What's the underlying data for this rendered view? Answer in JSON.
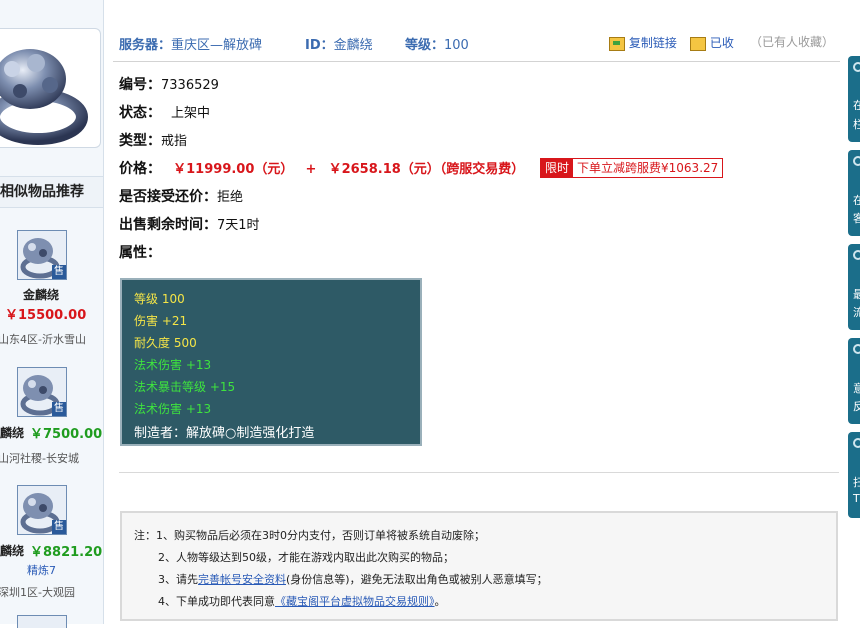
{
  "header": {
    "server_label": "服务器：",
    "server_value": "重庆区—解放碑",
    "id_label": "ID：",
    "id_value": "金麟绕",
    "level_label": "等级：",
    "level_value": "100",
    "copy_link": "复制链接",
    "collected": "已收",
    "watermark": "（已有人收藏）"
  },
  "item": {
    "number_label": "编号：",
    "number_value": "7336529",
    "status_label": "状态：",
    "status_value": "上架中",
    "type_label": "类型：",
    "type_value": "戒指",
    "price_label": "价格：",
    "price_main": "￥11999.00（元）",
    "price_plus": "+",
    "price_fee": "￥2658.18（元）（跨服交易费）",
    "promo_tag": "限时",
    "promo_text": "下单立减跨服费¥1063.27",
    "bargain_label": "是否接受还价：",
    "bargain_value": "拒绝",
    "remaining_label": "出售剩余时间：",
    "remaining_value": "7天1时",
    "attr_label": "属性："
  },
  "stats": [
    {
      "text": "等级 100",
      "color": "#f5e547"
    },
    {
      "text": "伤害 +21",
      "color": "#f5e547"
    },
    {
      "text": "耐久度 500",
      "color": "#f5e547"
    },
    {
      "text": "法术伤害 +13",
      "color": "#3ee33e"
    },
    {
      "text": "法术暴击等级 +15",
      "color": "#3ee33e"
    },
    {
      "text": "法术伤害 +13",
      "color": "#3ee33e"
    },
    {
      "text": "制造者：解放碑○制造强化打造",
      "color": "#ffffff"
    }
  ],
  "sidebar": {
    "title": "相似物品推荐",
    "items": [
      {
        "name": "金麟绕",
        "price": "￥15500.00",
        "server": "山东4区-沂水雪山",
        "sell": "售"
      },
      {
        "name": "麟绕",
        "price": "￥7500.00",
        "server": "山河社稷-长安城",
        "sell": "售"
      },
      {
        "name": "麟绕",
        "price": "￥8821.20",
        "extra": "精炼7",
        "server": "深圳1区-大观园",
        "sell": "售"
      }
    ]
  },
  "notes": {
    "prefix": "注：",
    "line1": "1、购买物品后必须在3时0分内支付，否则订单将被系统自动废除；",
    "line2": "2、人物等级达到50级，才能在游戏内取出此次购买的物品；",
    "line3_a": "3、请先",
    "line3_link": "完善帐号安全资料",
    "line3_b": "(身份信息等)，避免无法取出角色或被别人恶意填写；",
    "line4_a": "4、下单成功即代表同意",
    "line4_link": "《藏宝阁平台虚拟物品交易规则》",
    "line4_b": "。"
  },
  "side_tabs": [
    "在",
    "栏",
    "在",
    "客",
    "最",
    "流",
    "意",
    "反",
    "扫",
    "T"
  ],
  "colors": {
    "accent_blue": "#3b6bb0",
    "price_red": "#d8161b",
    "price_green": "#1f9c1f",
    "stats_bg": "#2e5a66",
    "side_tab": "#1b6e8a"
  }
}
